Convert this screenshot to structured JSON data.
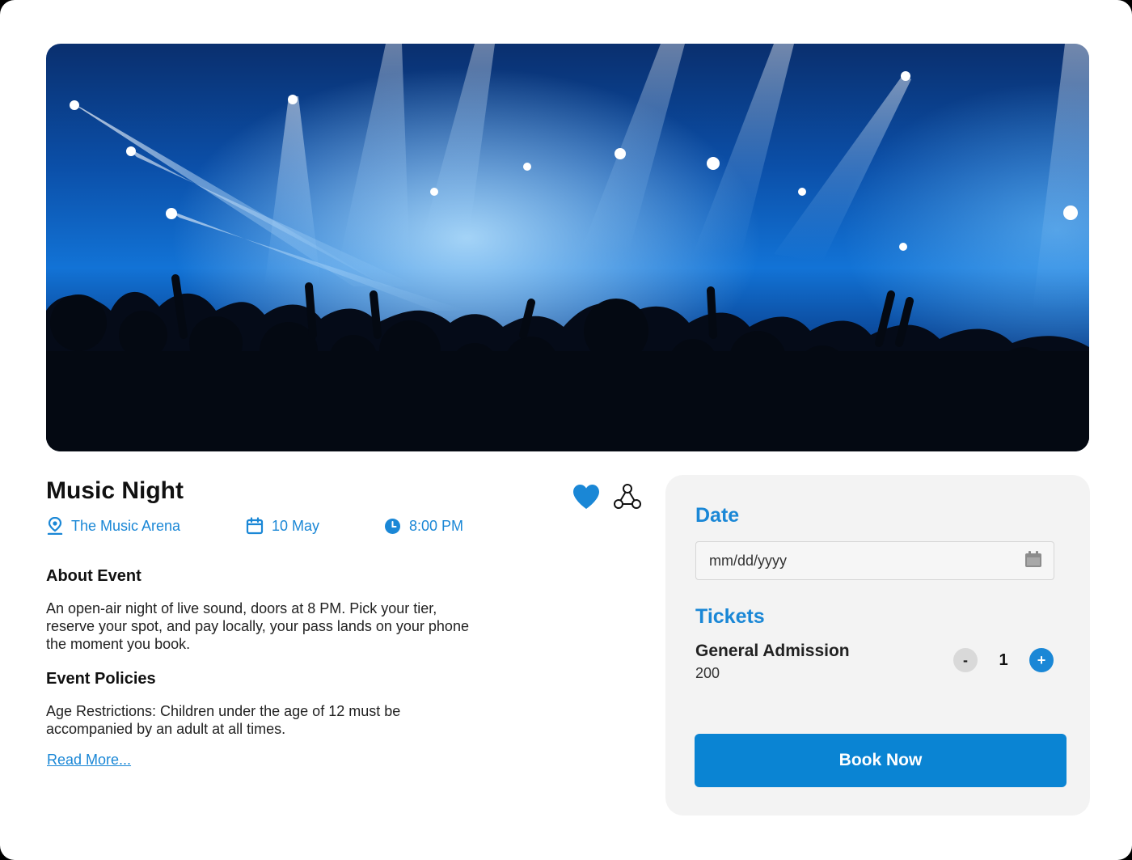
{
  "event": {
    "title": "Music Night",
    "venue": "The Music Arena",
    "date": "10 May",
    "time": "8:00 PM",
    "hero_icon": "concert-crowd-photo"
  },
  "icons": {
    "location": "location-pin-icon",
    "calendar": "calendar-icon",
    "clock": "clock-icon",
    "favorite": "heart-icon",
    "share": "share-icon"
  },
  "about": {
    "heading": "About Event",
    "text": "An open-air night of live sound, doors at 8 PM. Pick your tier, reserve your spot, and pay locally, your pass lands on your phone the moment you book."
  },
  "policies": {
    "heading": "Event Policies",
    "text": "Age Restrictions: Children under the age of 12 must be accompanied by an adult at all times.",
    "read_more": "Read More..."
  },
  "booking": {
    "date_heading": "Date",
    "date_placeholder": "mm/dd/yyyy",
    "tickets_heading": "Tickets",
    "ticket": {
      "name": "General Admission",
      "price": "200",
      "quantity": "1",
      "minus_label": "-",
      "plus_label": "+"
    },
    "book_label": "Book Now"
  },
  "colors": {
    "accent": "#1a87d6",
    "button": "#0a84d3",
    "card_bg": "#f3f3f3"
  }
}
